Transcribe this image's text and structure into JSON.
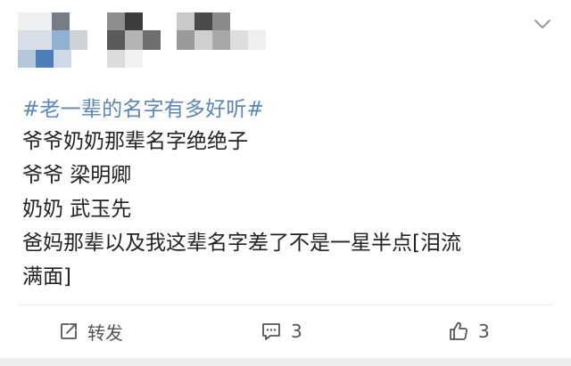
{
  "post": {
    "topic": "#老一辈的名字有多好听#",
    "lines": [
      "爷爷奶奶那辈名字绝绝子",
      "爷爷 梁明卿",
      "奶奶 武玉先",
      "爸妈那辈以及我这辈名字差了不是一星半点[泪流",
      "满面]"
    ]
  },
  "actions": {
    "repost_label": "转发",
    "comment_count": "3",
    "like_count": "3"
  },
  "colors": {
    "topic": "#5b86b4",
    "text": "#222222",
    "icon": "#555555"
  },
  "icons": {
    "menu": "chevron-down-icon",
    "repost": "repost-icon",
    "comment": "comment-icon",
    "like": "thumbs-up-icon"
  }
}
